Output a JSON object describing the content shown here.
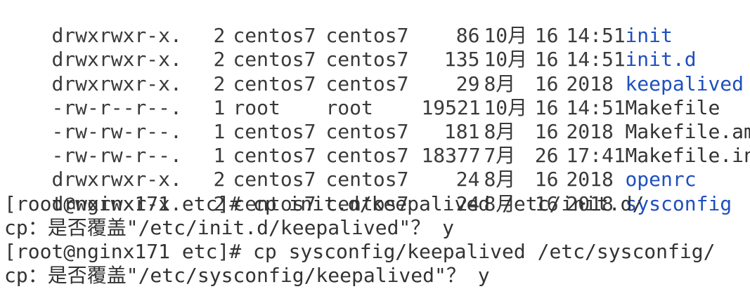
{
  "colors": {
    "background": "#ffffff",
    "text": "#333333",
    "directory": "#1e4fbf"
  },
  "listing": [
    {
      "perm": "drwxrwxr-x.",
      "links": "2",
      "user": "centos7",
      "group": "centos7",
      "size": "86",
      "month": "10月",
      "day": "16",
      "time": "14:51",
      "name": "init",
      "type": "dir"
    },
    {
      "perm": "drwxrwxr-x.",
      "links": "2",
      "user": "centos7",
      "group": "centos7",
      "size": "135",
      "month": "10月",
      "day": "16",
      "time": "14:51",
      "name": "init.d",
      "type": "dir"
    },
    {
      "perm": "drwxrwxr-x.",
      "links": "2",
      "user": "centos7",
      "group": "centos7",
      "size": "29",
      "month": "8月",
      "day": "16",
      "time": "2018",
      "name": "keepalived",
      "type": "dir"
    },
    {
      "perm": "-rw-r--r--.",
      "links": "1",
      "user": "root",
      "group": "root",
      "size": "19521",
      "month": "10月",
      "day": "16",
      "time": "14:51",
      "name": "Makefile",
      "type": "file"
    },
    {
      "perm": "-rw-rw-r--.",
      "links": "1",
      "user": "centos7",
      "group": "centos7",
      "size": "181",
      "month": "8月",
      "day": "16",
      "time": "2018",
      "name": "Makefile.am",
      "type": "file"
    },
    {
      "perm": "-rw-rw-r--.",
      "links": "1",
      "user": "centos7",
      "group": "centos7",
      "size": "18377",
      "month": "7月",
      "day": "26",
      "time": "17:41",
      "name": "Makefile.in",
      "type": "file"
    },
    {
      "perm": "drwxrwxr-x.",
      "links": "2",
      "user": "centos7",
      "group": "centos7",
      "size": "24",
      "month": "8月",
      "day": "16",
      "time": "2018",
      "name": "openrc",
      "type": "dir"
    },
    {
      "perm": "drwxrwxr-x.",
      "links": "2",
      "user": "centos7",
      "group": "centos7",
      "size": "24",
      "month": "8月",
      "day": "16",
      "time": "2018",
      "name": "sysconfig",
      "type": "dir"
    }
  ],
  "session": [
    {
      "text": "[root@nginx171 etc]# cp init.d/keepalived /etc/init.d/"
    },
    {
      "text": "cp：是否覆盖\"/etc/init.d/keepalived\"？ y"
    },
    {
      "text": "[root@nginx171 etc]# cp sysconfig/keepalived /etc/sysconfig/"
    },
    {
      "text": "cp：是否覆盖\"/etc/sysconfig/keepalived\"？ y"
    }
  ]
}
